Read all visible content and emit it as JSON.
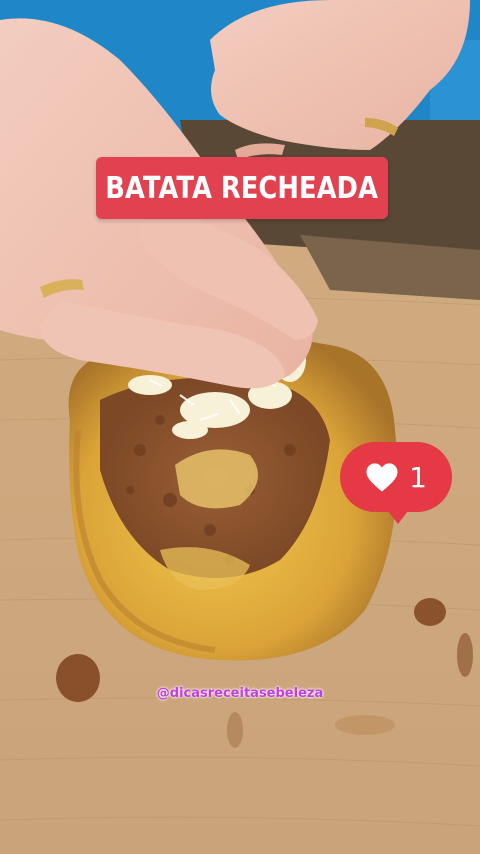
{
  "overlay": {
    "title": "BATATA RECHEADA",
    "like_count": "1",
    "handle": "@dicasreceitasebeleza"
  },
  "colors": {
    "banner": "#e2414f",
    "like_badge": "#e53945",
    "handle": "#c13fe0"
  },
  "icons": [
    "heart-icon"
  ]
}
